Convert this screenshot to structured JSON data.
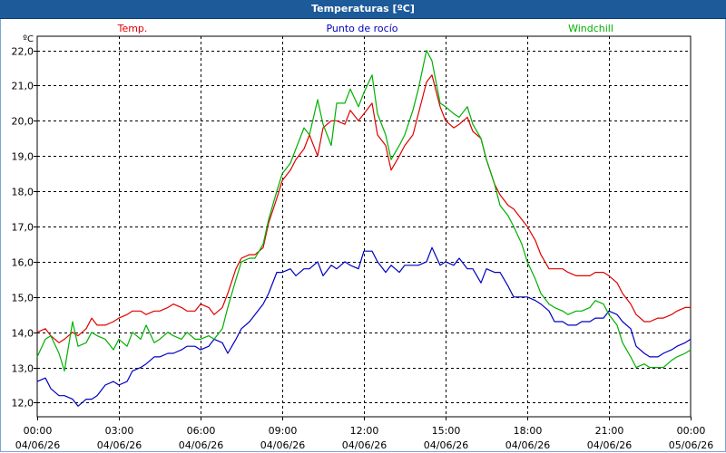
{
  "window": {
    "title": "Temperaturas [ºC]"
  },
  "chart_data": {
    "type": "line",
    "unit_label": "ºC",
    "ylim": [
      11.6,
      22.4
    ],
    "yticks": [
      "12,0",
      "13,0",
      "14,0",
      "15,0",
      "16,0",
      "17,0",
      "18,0",
      "19,0",
      "20,0",
      "21,0",
      "22,0"
    ],
    "ytick_values": [
      12,
      13,
      14,
      15,
      16,
      17,
      18,
      19,
      20,
      21,
      22
    ],
    "xlim": [
      0,
      24
    ],
    "xticks": [
      {
        "time": "00:00",
        "date": "04/06/26"
      },
      {
        "time": "03:00",
        "date": "04/06/26"
      },
      {
        "time": "06:00",
        "date": "04/06/26"
      },
      {
        "time": "09:00",
        "date": "04/06/26"
      },
      {
        "time": "12:00",
        "date": "04/06/26"
      },
      {
        "time": "15:00",
        "date": "04/06/26"
      },
      {
        "time": "18:00",
        "date": "04/06/26"
      },
      {
        "time": "21:00",
        "date": "04/06/26"
      },
      {
        "time": "00:00",
        "date": "05/06/26"
      }
    ],
    "xtick_hours": [
      0,
      3,
      6,
      9,
      12,
      15,
      18,
      21,
      24
    ],
    "grid": true,
    "series": [
      {
        "name": "Temp.",
        "color": "#e00000",
        "x": [
          0,
          0.3,
          0.5,
          0.8,
          1.0,
          1.3,
          1.5,
          1.8,
          2.0,
          2.2,
          2.5,
          2.8,
          3.0,
          3.3,
          3.5,
          3.8,
          4.0,
          4.3,
          4.5,
          4.8,
          5.0,
          5.3,
          5.5,
          5.8,
          6.0,
          6.3,
          6.5,
          6.8,
          7.0,
          7.3,
          7.5,
          7.8,
          8.0,
          8.3,
          8.5,
          8.8,
          9.0,
          9.3,
          9.5,
          9.8,
          10.0,
          10.3,
          10.5,
          10.8,
          11.0,
          11.3,
          11.5,
          11.8,
          12.0,
          12.3,
          12.5,
          12.8,
          13.0,
          13.3,
          13.5,
          13.8,
          14.0,
          14.3,
          14.5,
          14.8,
          15.0,
          15.3,
          15.5,
          15.8,
          16.0,
          16.3,
          16.5,
          16.8,
          17.0,
          17.3,
          17.5,
          17.8,
          18.0,
          18.3,
          18.5,
          18.8,
          19.0,
          19.3,
          19.5,
          19.8,
          20.0,
          20.3,
          20.5,
          20.8,
          21.0,
          21.3,
          21.5,
          21.8,
          22.0,
          22.3,
          22.5,
          22.8,
          23.0,
          23.3,
          23.5,
          23.8,
          24.0
        ],
        "y": [
          14.0,
          14.1,
          13.9,
          13.7,
          13.8,
          14.0,
          13.9,
          14.1,
          14.4,
          14.2,
          14.2,
          14.3,
          14.4,
          14.5,
          14.6,
          14.6,
          14.5,
          14.6,
          14.6,
          14.7,
          14.8,
          14.7,
          14.6,
          14.6,
          14.8,
          14.7,
          14.5,
          14.7,
          15.1,
          15.8,
          16.1,
          16.2,
          16.2,
          16.4,
          17.1,
          17.8,
          18.3,
          18.6,
          18.9,
          19.2,
          19.6,
          19.0,
          19.8,
          20.0,
          20.0,
          19.9,
          20.3,
          20.0,
          20.2,
          20.5,
          19.6,
          19.3,
          18.6,
          19.0,
          19.3,
          19.6,
          20.2,
          21.1,
          21.3,
          20.4,
          20.0,
          19.8,
          19.9,
          20.1,
          19.7,
          19.5,
          18.9,
          18.2,
          17.9,
          17.6,
          17.5,
          17.2,
          17.0,
          16.6,
          16.2,
          15.8,
          15.8,
          15.8,
          15.7,
          15.6,
          15.6,
          15.6,
          15.7,
          15.7,
          15.6,
          15.4,
          15.1,
          14.8,
          14.5,
          14.3,
          14.3,
          14.4,
          14.4,
          14.5,
          14.6,
          14.7,
          14.7
        ]
      },
      {
        "name": "Punto de rocío",
        "color": "#0000c0",
        "x": [
          0,
          0.3,
          0.5,
          0.8,
          1.0,
          1.3,
          1.5,
          1.8,
          2.0,
          2.2,
          2.5,
          2.8,
          3.0,
          3.3,
          3.5,
          3.8,
          4.0,
          4.3,
          4.5,
          4.8,
          5.0,
          5.3,
          5.5,
          5.8,
          6.0,
          6.3,
          6.5,
          6.8,
          7.0,
          7.3,
          7.5,
          7.8,
          8.0,
          8.3,
          8.5,
          8.8,
          9.0,
          9.3,
          9.5,
          9.8,
          10.0,
          10.3,
          10.5,
          10.8,
          11.0,
          11.3,
          11.5,
          11.8,
          12.0,
          12.3,
          12.5,
          12.8,
          13.0,
          13.3,
          13.5,
          13.8,
          14.0,
          14.3,
          14.5,
          14.8,
          15.0,
          15.3,
          15.5,
          15.8,
          16.0,
          16.3,
          16.5,
          16.8,
          17.0,
          17.3,
          17.5,
          17.8,
          18.0,
          18.3,
          18.5,
          18.8,
          19.0,
          19.3,
          19.5,
          19.8,
          20.0,
          20.3,
          20.5,
          20.8,
          21.0,
          21.3,
          21.5,
          21.8,
          22.0,
          22.3,
          22.5,
          22.8,
          23.0,
          23.3,
          23.5,
          23.8,
          24.0
        ],
        "y": [
          12.6,
          12.7,
          12.4,
          12.2,
          12.2,
          12.1,
          11.9,
          12.1,
          12.1,
          12.2,
          12.5,
          12.6,
          12.5,
          12.6,
          12.9,
          13.0,
          13.1,
          13.3,
          13.3,
          13.4,
          13.4,
          13.5,
          13.6,
          13.6,
          13.5,
          13.6,
          13.8,
          13.7,
          13.4,
          13.8,
          14.1,
          14.3,
          14.5,
          14.8,
          15.1,
          15.7,
          15.7,
          15.8,
          15.6,
          15.8,
          15.8,
          16.0,
          15.6,
          15.9,
          15.8,
          16.0,
          15.9,
          15.8,
          16.3,
          16.3,
          16.0,
          15.7,
          15.9,
          15.7,
          15.9,
          15.9,
          15.9,
          16.0,
          16.4,
          15.9,
          16.0,
          15.9,
          16.1,
          15.8,
          15.8,
          15.4,
          15.8,
          15.7,
          15.7,
          15.3,
          15.0,
          15.0,
          15.0,
          14.9,
          14.8,
          14.6,
          14.3,
          14.3,
          14.2,
          14.2,
          14.3,
          14.3,
          14.4,
          14.4,
          14.6,
          14.5,
          14.3,
          14.1,
          13.6,
          13.4,
          13.3,
          13.3,
          13.4,
          13.5,
          13.6,
          13.7,
          13.8
        ]
      },
      {
        "name": "Windchill",
        "color": "#00b000",
        "x": [
          0,
          0.3,
          0.5,
          0.8,
          1.0,
          1.3,
          1.5,
          1.8,
          2.0,
          2.2,
          2.5,
          2.8,
          3.0,
          3.3,
          3.5,
          3.8,
          4.0,
          4.3,
          4.5,
          4.8,
          5.0,
          5.3,
          5.5,
          5.8,
          6.0,
          6.3,
          6.5,
          6.8,
          7.0,
          7.3,
          7.5,
          7.8,
          8.0,
          8.3,
          8.5,
          8.8,
          9.0,
          9.3,
          9.5,
          9.8,
          10.0,
          10.3,
          10.5,
          10.8,
          11.0,
          11.3,
          11.5,
          11.8,
          12.0,
          12.3,
          12.5,
          12.8,
          13.0,
          13.3,
          13.5,
          13.8,
          14.0,
          14.3,
          14.5,
          14.8,
          15.0,
          15.3,
          15.5,
          15.8,
          16.0,
          16.3,
          16.5,
          16.8,
          17.0,
          17.3,
          17.5,
          17.8,
          18.0,
          18.3,
          18.5,
          18.8,
          19.0,
          19.3,
          19.5,
          19.8,
          20.0,
          20.3,
          20.5,
          20.8,
          21.0,
          21.3,
          21.5,
          21.8,
          22.0,
          22.3,
          22.5,
          22.8,
          23.0,
          23.3,
          23.5,
          23.8,
          24.0
        ],
        "y": [
          13.3,
          13.8,
          13.9,
          13.4,
          12.9,
          14.3,
          13.6,
          13.7,
          14.0,
          13.9,
          13.8,
          13.5,
          13.8,
          13.6,
          14.0,
          13.8,
          14.2,
          13.7,
          13.8,
          14.0,
          13.9,
          13.8,
          14.0,
          13.8,
          13.8,
          13.9,
          13.8,
          14.1,
          14.7,
          15.5,
          16.0,
          16.1,
          16.1,
          16.5,
          17.2,
          18.0,
          18.5,
          18.8,
          19.2,
          19.8,
          19.6,
          20.6,
          19.9,
          19.3,
          20.5,
          20.5,
          20.9,
          20.4,
          20.8,
          21.3,
          20.2,
          19.6,
          18.9,
          19.3,
          19.6,
          20.3,
          20.9,
          22.0,
          21.7,
          20.5,
          20.4,
          20.2,
          20.1,
          20.4,
          19.9,
          19.5,
          18.9,
          18.2,
          17.6,
          17.3,
          17.0,
          16.5,
          16.0,
          15.5,
          15.1,
          14.8,
          14.7,
          14.6,
          14.5,
          14.6,
          14.6,
          14.7,
          14.9,
          14.8,
          14.5,
          14.2,
          13.7,
          13.3,
          13.0,
          13.1,
          13.0,
          13.0,
          13.0,
          13.2,
          13.3,
          13.4,
          13.5
        ]
      }
    ]
  }
}
